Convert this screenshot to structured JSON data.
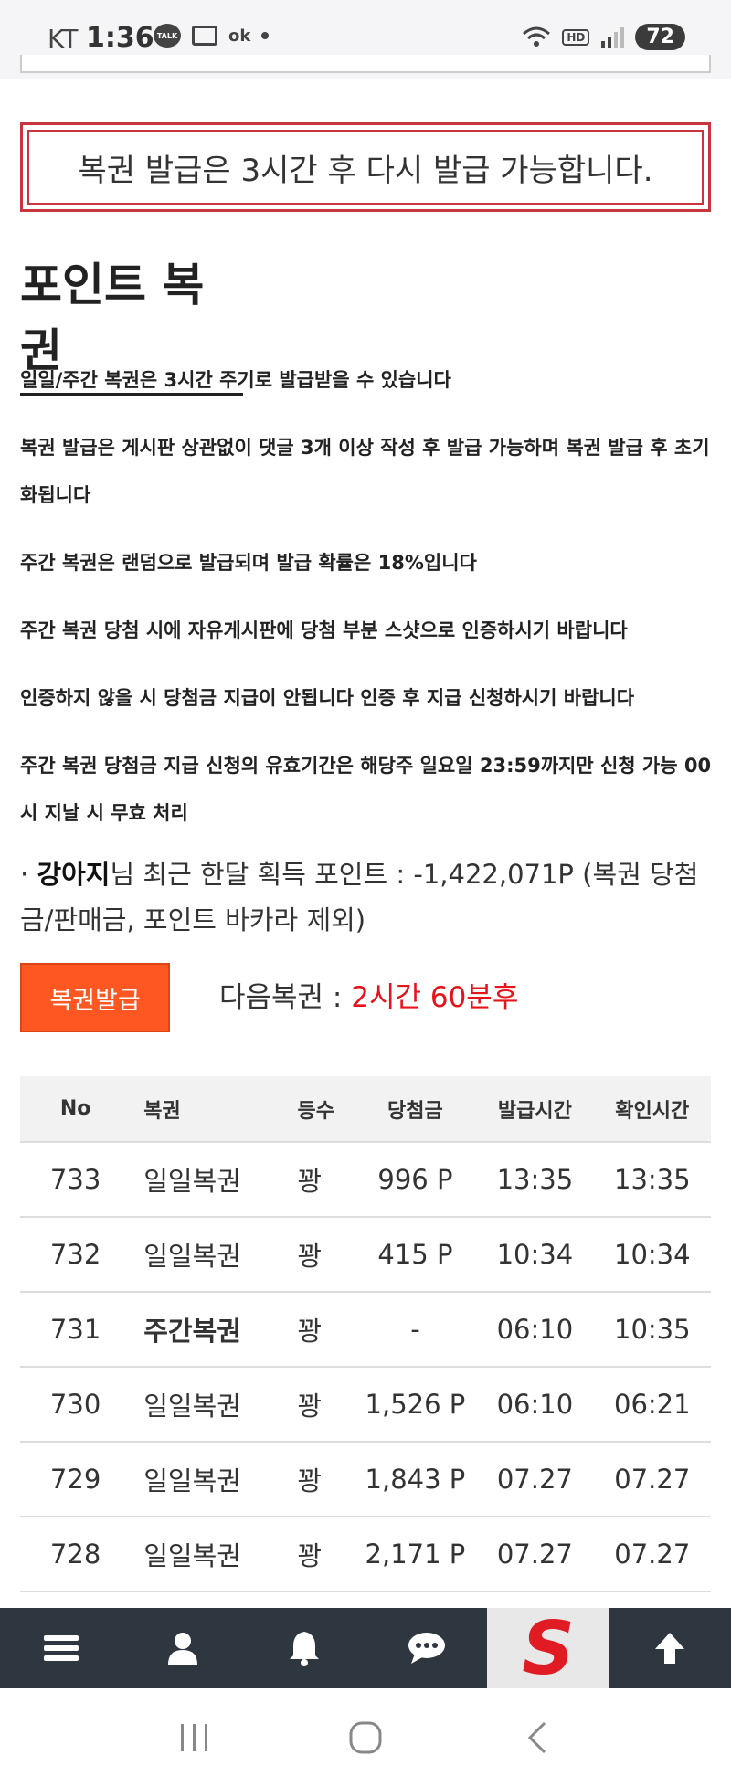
{
  "status_bar": {
    "carrier": "KT",
    "time": "1:36",
    "talk_badge": "TALK",
    "ok_badge": "ok",
    "hd_badge": "HD",
    "battery": "72"
  },
  "notice": {
    "text": "복권 발급은 3시간 후 다시 발급 가능합니다."
  },
  "page_title": "포인트 복권",
  "rules": [
    "일일/주간 복권은 3시간 주기로 발급받을 수 있습니다",
    "복권 발급은 게시판 상관없이 댓글 3개 이상 작성 후 발급 가능하며 복권 발급 후 초기화됩니다",
    "주간 복권은 랜덤으로 발급되며 발급 확률은 18%입니다",
    "주간 복권 당첨 시에 자유게시판에 당첨 부분 스샷으로 인증하시기 바랍니다",
    "인증하지 않을 시 당첨금 지급이 안됩니다 인증 후 지급 신청하시기 바랍니다",
    "주간 복권 당첨금 지급 신청의 유효기간은 해당주 일요일 23:59까지만 신청 가능 00시 지날 시 무효 처리"
  ],
  "points": {
    "bullet": "·",
    "username": "강아지",
    "text": "님 최근 한달 획득 포인트 : -1,422,071P (복권 당첨금/판매금, 포인트 바카라 제외)"
  },
  "issue_button_label": "복권발급",
  "next_ticket": {
    "label": "다음복권 : ",
    "value": "2시간 60분후"
  },
  "table": {
    "headers": [
      "No",
      "복권",
      "등수",
      "당첨금",
      "발급시간",
      "확인시간"
    ],
    "rows": [
      {
        "no": "733",
        "name": "일일복권",
        "grade": "꽝",
        "prize": "996 P",
        "issued": "13:35",
        "checked": "13:35",
        "weekly": false
      },
      {
        "no": "732",
        "name": "일일복권",
        "grade": "꽝",
        "prize": "415 P",
        "issued": "10:34",
        "checked": "10:34",
        "weekly": false
      },
      {
        "no": "731",
        "name": "주간복권",
        "grade": "꽝",
        "prize": "-",
        "issued": "06:10",
        "checked": "10:35",
        "weekly": true
      },
      {
        "no": "730",
        "name": "일일복권",
        "grade": "꽝",
        "prize": "1,526 P",
        "issued": "06:10",
        "checked": "06:21",
        "weekly": false
      },
      {
        "no": "729",
        "name": "일일복권",
        "grade": "꽝",
        "prize": "1,843 P",
        "issued": "07.27",
        "checked": "07.27",
        "weekly": false
      },
      {
        "no": "728",
        "name": "일일복권",
        "grade": "꽝",
        "prize": "2,171 P",
        "issued": "07.27",
        "checked": "07.27",
        "weekly": false
      }
    ]
  },
  "toolbar": {
    "icons": [
      "menu-icon",
      "user-icon",
      "bell-icon",
      "chat-icon",
      "site-logo",
      "scroll-top-icon"
    ],
    "logo_letter": "S"
  },
  "colors": {
    "accent_red": "#c8353f",
    "button_orange": "#ff5722",
    "highlight_red": "#e4141a",
    "toolbar_bg": "#2e3640"
  }
}
